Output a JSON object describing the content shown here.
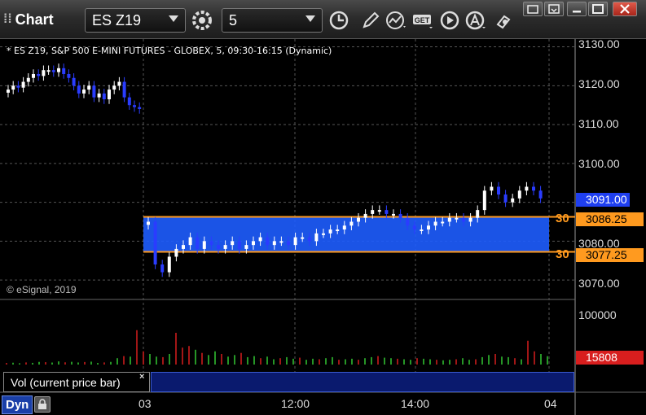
{
  "toolbar": {
    "app_title": "Chart",
    "symbol": "ES Z19",
    "interval": "5"
  },
  "chart": {
    "legend": "* ES Z19, S&P 500 E-MINI FUTURES - GLOBEX, 5, 09:30-16:15 (Dynamic)",
    "copyright": "© eSignal, 2019",
    "price_ticks": [
      "3130.00",
      "3120.00",
      "3110.00",
      "3100.00",
      "3080.00",
      "3070.00"
    ],
    "time_ticks": [
      "03",
      "12:00",
      "14:00",
      "04"
    ],
    "last_price": "3091.00",
    "range_high": "3086.25",
    "range_low": "3077.25",
    "range_high_tag": "30",
    "range_low_tag": "30",
    "colors": {
      "up": "#ffffff",
      "down": "#2a3cff",
      "box": "#1e5dff",
      "box_border": "#ff9a1f",
      "volume_up": "#32c832",
      "volume_down": "#d81e1e"
    }
  },
  "volume": {
    "panel_label": "Vol (current price bar)",
    "close_glyph": "×",
    "tick": "100000",
    "last_volume": "15808"
  },
  "footer": {
    "mode": "Dyn"
  },
  "chart_data": {
    "type": "candlestick",
    "ylim": [
      3065,
      3132
    ],
    "series": [
      {
        "name": "ES Z19",
        "values": [
          3119,
          3120,
          3119.5,
          3121,
          3122,
          3123,
          3122.5,
          3124,
          3124,
          3123.5,
          3124.5,
          3123,
          3122,
          3120,
          3118,
          3119,
          3120,
          3117,
          3118,
          3116.5,
          3119,
          3120,
          3121,
          3117,
          3115,
          3114.5,
          3114,
          3085,
          3074,
          3072,
          3076,
          3078,
          3079,
          3081,
          3078,
          3080,
          3079,
          3078,
          3079,
          3080,
          3078,
          3079,
          3080,
          3081,
          3079,
          3080,
          3080,
          3079,
          3081,
          3081,
          3080,
          3082,
          3082,
          3083,
          3083,
          3084,
          3085,
          3086,
          3087,
          3088,
          3088,
          3087,
          3087,
          3086,
          3084,
          3083,
          3083,
          3084,
          3085,
          3085,
          3086,
          3086,
          3085,
          3086,
          3088,
          3093,
          3094,
          3092,
          3090,
          3091,
          3093,
          3094,
          3093,
          3091
        ]
      }
    ],
    "volume_ylim": [
      0,
      120000
    ],
    "volume": [
      3000,
      3500,
      2500,
      4000,
      3200,
      5000,
      4500,
      3800,
      6000,
      4200,
      5200,
      3900,
      4800,
      5500,
      3000,
      4000,
      5000,
      12000,
      16000,
      15000,
      65000,
      25000,
      20000,
      15000,
      14000,
      20000,
      60000,
      32000,
      35000,
      28000,
      22000,
      18000,
      25000,
      20000,
      15000,
      18000,
      22000,
      14000,
      16000,
      12000,
      15000,
      10000,
      12000,
      14000,
      11000,
      13000,
      9000,
      11000,
      10000,
      12000,
      14000,
      9000,
      10000,
      11000,
      9000,
      12000,
      14000,
      16000,
      13000,
      12000,
      11000,
      10000,
      9000,
      12000,
      11000,
      10000,
      9000,
      8000,
      9000,
      10000,
      12000,
      9000,
      10000,
      14000,
      18000,
      20000,
      15000,
      14000,
      12000,
      10000,
      45000,
      25000,
      20000,
      15808
    ]
  }
}
